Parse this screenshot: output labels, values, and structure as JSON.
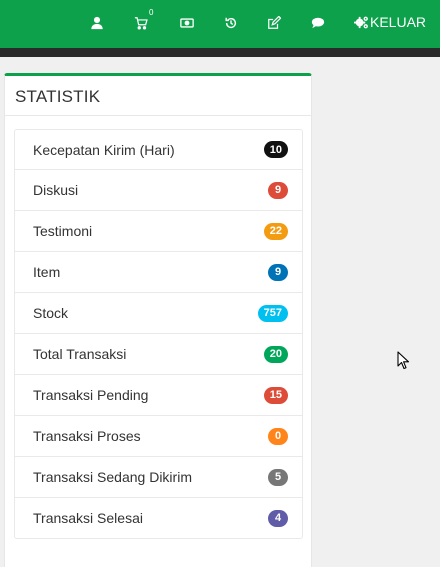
{
  "nav": {
    "cart_count": "0",
    "logout_label": "KELUAR",
    "icons": [
      "user-icon",
      "cart-icon",
      "money-icon",
      "history-icon",
      "edit-icon",
      "chat-icon",
      "gears-icon"
    ]
  },
  "panel": {
    "title": "STATISTIK",
    "accent_color": "#0ea14b",
    "items": [
      {
        "label": "Kecepatan Kirim (Hari)",
        "value": "10",
        "color": "#111111"
      },
      {
        "label": "Diskusi",
        "value": "9",
        "color": "#dd4b39"
      },
      {
        "label": "Testimoni",
        "value": "22",
        "color": "#f39c12"
      },
      {
        "label": "Item",
        "value": "9",
        "color": "#0073b7"
      },
      {
        "label": "Stock",
        "value": "757",
        "color": "#00c0ef"
      },
      {
        "label": "Total Transaksi",
        "value": "20",
        "color": "#00a65a"
      },
      {
        "label": "Transaksi Pending",
        "value": "15",
        "color": "#dd4b39"
      },
      {
        "label": "Transaksi Proses",
        "value": "0",
        "color": "#ff851b"
      },
      {
        "label": "Transaksi Sedang Dikirim",
        "value": "5",
        "color": "#777777"
      },
      {
        "label": "Transaksi Selesai",
        "value": "4",
        "color": "#605ca8"
      }
    ]
  }
}
